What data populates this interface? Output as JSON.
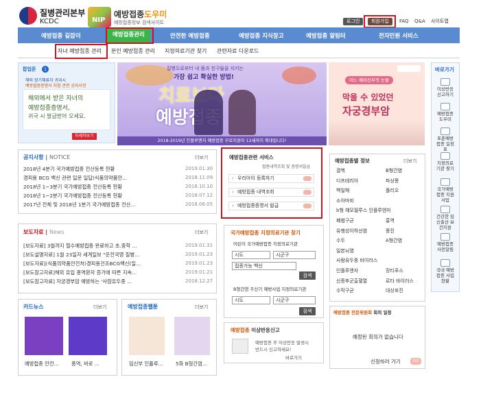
{
  "header": {
    "org_name": "질병관리본부",
    "org_abbr": "KCDC",
    "nip_mark": "NIP",
    "site_title_a": "예방접종",
    "site_title_b": "도우미",
    "site_subtitle": "예방접종정보 검색사이트",
    "login": "로그인",
    "join": "회원가입",
    "faq": "FAQ",
    "qna": "Q&A",
    "sitemap": "사이트맵"
  },
  "nav": {
    "items": [
      "예방접종 길잡이",
      "예방접종관리",
      "안전한 예방접종",
      "예방접종 지식창고",
      "예방접종 알림터",
      "전자민원 서비스"
    ]
  },
  "subnav": {
    "items": [
      "자녀 예방접종 관리",
      "본인 예방접종 관리",
      "지정의료기관 찾기",
      "관련자료 다운로드"
    ]
  },
  "popup": {
    "label": "팝업존",
    "count": "1",
    "line1": "해외 장기체류자 귀국시",
    "line2": "예방접종증명서 지참 관련 공지사항",
    "line3": "해외에서 받은 자녀의",
    "line4": "예방접종증명서,",
    "line5": "귀국 시 발급받아 오세요.",
    "more": "자세히보기"
  },
  "main_banner": {
    "line1": "질병으로부터 내 몸과 친구들을 지키는",
    "line2": "가장 쉽고 확실한 방법!",
    "line3": "치료보다",
    "line4": "예방접종",
    "caption": "2018-2019년 인플루엔자 예방접종 무료지원이 12세까지 확대됩니다!"
  },
  "right_banner": {
    "line1": "어느 예비신부의 눈물",
    "line2": "막을 수 있었던",
    "line3": "자궁경부암"
  },
  "notice": {
    "title": "공지사항",
    "title_en": "NOTICE",
    "more": "더보기",
    "rows": [
      {
        "text": "2018년 4분기 국가예방접종 전산등록 현황",
        "date": "2019.01.30"
      },
      {
        "text": "경피용 BCG 백신 관련 일문 일답(식품의약품안...",
        "date": "2018.11.09"
      },
      {
        "text": "2018년 1~3분기 국가예방접종 전산등록 현황",
        "date": "2018.10.10"
      },
      {
        "text": "2018년 1~2분기 국가예방접종 전산등록 현황",
        "date": "2018.07.12"
      },
      {
        "text": "2017년 전체 및 2018년 1분기 국가예방접종 전산...",
        "date": "2018.06.05"
      }
    ]
  },
  "press": {
    "title": "보도자료",
    "title_en": "News",
    "more": "더보기",
    "rows": [
      {
        "text": "[보도자료] 3월까지 필수예방접종 완료하고 초.중학 ...",
        "date": "2019.01.31"
      },
      {
        "text": "[보도설명자료] 1월 23일자 세계일보 \"운전국영 질병...",
        "date": "2019.01.23"
      },
      {
        "text": "[보도자료](식품의약품안전처)경피용건조BCG백신(일...",
        "date": "2019.01.23"
      },
      {
        "text": "[보도참고자료]해외 유입 홍역환자 증가에 따른 지속...",
        "date": "2019.01.21"
      },
      {
        "text": "[보도참고자료] 자궁경부암 예방하는 '사람유두종 ...",
        "date": "2018.12.27"
      }
    ]
  },
  "cardnews": {
    "title": "카드뉴스",
    "more": "더보기",
    "items": [
      "예방접종 안전...",
      "홍역, 바로 ..."
    ]
  },
  "webtoon": {
    "title": "예방접종웹툰",
    "more": "더보기",
    "items": [
      "임신부 인플루...",
      "5화 B형간염..."
    ]
  },
  "service": {
    "title": "예방접종관련 서비스",
    "subtitle": "접종내역조회 및 증명서발급",
    "items": [
      "우리아이 등록하기",
      "예방접종 내역조회",
      "예방접종증명서 발급"
    ]
  },
  "clinic": {
    "title": "국가예방접종 지정의료기관 찾기",
    "child_label": "어린이 국가예방접종 지정의료기관",
    "sido": "시도",
    "sigungu": "시군구",
    "vaccine": "접종가능 백신",
    "search": "검색",
    "hepb_label": "B형간염 주산기 예방사업 지정의료기관",
    "sido2": "시도",
    "sigungu2": "시군구",
    "search2": "검색"
  },
  "adverse": {
    "title": "예방접종",
    "title_b": "이상반응신고",
    "line1": "예방접종 후 이상반응 발생시",
    "line2": "반드시 신고하세요!",
    "go": "바로가기"
  },
  "vaccine_info": {
    "title": "예방접종별 정보",
    "more": "더보기",
    "left": [
      "결핵",
      "디프테리아",
      "백일해",
      "소아마비",
      "b형 헤모필루스 인플루엔자",
      "폐렴구균",
      "유행성이하선염",
      "수두",
      "일본뇌염",
      "사람유두종 바이러스",
      "인플루엔자",
      "신증후군출혈열",
      "수막구균"
    ],
    "right": [
      "B형간염",
      "파상풍",
      "폴리오",
      "",
      "",
      "홍역",
      "풍진",
      "A형간염",
      "",
      "",
      "장티푸스",
      "로타 바이러스",
      "대상포진"
    ]
  },
  "committee": {
    "title": "예방접종 전문위원회",
    "title_b": "회의 일정",
    "empty": "예정된 회의가 없습니다",
    "apply": "신청하러 가기",
    "go": "GO"
  },
  "quick": {
    "title": "바로가기",
    "items": [
      "이상반응 신고하기",
      "예방접종 도우미",
      "표준예방접종 일정표",
      "지정의료기관 찾기",
      "국가예방접종 지원사업",
      "건강한 임신출산 보건지원",
      "예방접종 사전알림",
      "국내 예방접종 사업현황"
    ]
  },
  "colors": {
    "nav": "#5a8ad0",
    "nav_active": "#3bb54a",
    "highlight": "#d0101c",
    "title_blue": "#1f66c2"
  }
}
